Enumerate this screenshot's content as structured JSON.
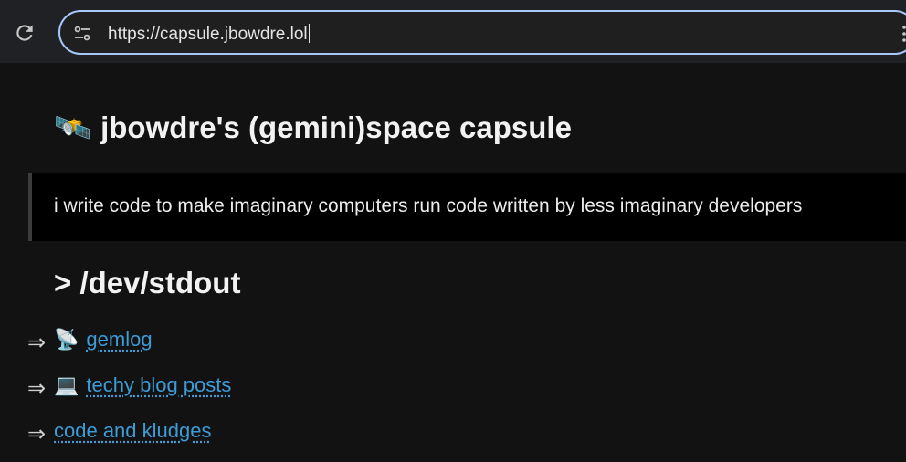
{
  "browser": {
    "url": "https://capsule.jbowdre.lol",
    "icons": {
      "reload": "reload-icon",
      "site_info": "tune-icon",
      "menu": "menu-dots-icon"
    },
    "accent": "#a8c7fa"
  },
  "page": {
    "title_emoji": "🛰️",
    "title": "jbowdre's (gemini)space capsule",
    "tagline": "i write code to make imaginary computers run code written by less imaginary developers",
    "section_heading": "> /dev/stdout",
    "arrow_glyph": "⇒",
    "links": [
      {
        "emoji": "📡",
        "label": "gemlog"
      },
      {
        "emoji": "💻",
        "label": "techy blog posts"
      },
      {
        "emoji": "",
        "label": "code and kludges"
      }
    ],
    "link_color": "#3d9bd6"
  }
}
